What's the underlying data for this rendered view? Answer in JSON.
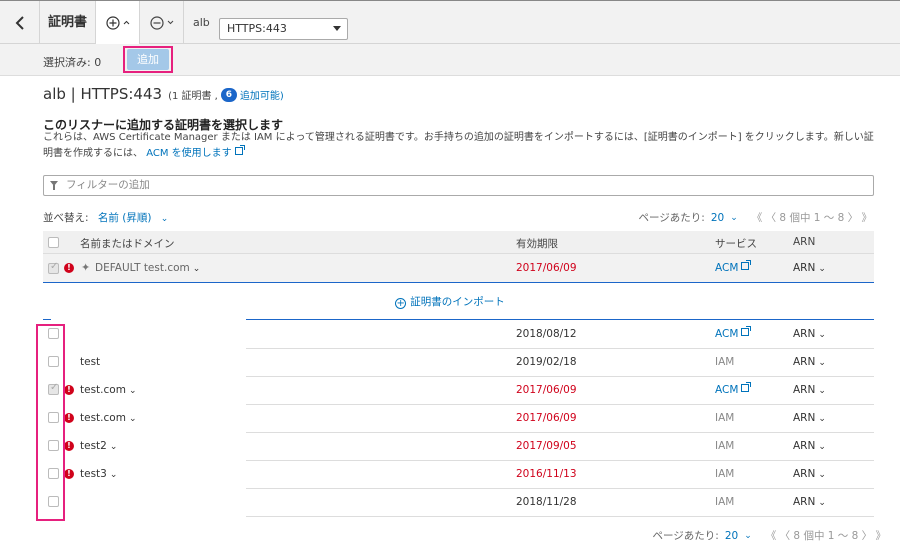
{
  "toolbar": {
    "title": "証明書",
    "load_balancer": "alb",
    "listener": "HTTPS:443"
  },
  "subbar": {
    "selected": "選択済み: 0",
    "add_button": "追加"
  },
  "heading": {
    "title": "alb | HTTPS:443",
    "meta_prefix": "(1 証明書 ,",
    "available_count": "6",
    "meta_link": "追加可能)"
  },
  "section": {
    "title": "このリスナーに追加する証明書を選択します",
    "desc_part1": "これらは、AWS Certificate Manager または IAM によって管理される証明書です。お手持ちの追加の証明書をインポートするには、[証明書のインポート] をクリックします。新しい証明書を作成するには、",
    "desc_link": "ACM を使用します"
  },
  "filter": {
    "placeholder": "フィルターの追加"
  },
  "sort": {
    "label": "並べ替え:",
    "value": "名前 (昇順)"
  },
  "pager": {
    "label": "ページあたり:",
    "size": "20",
    "range": "《 〈 8 個中 1 ～ 8 〉 》"
  },
  "columns": {
    "name": "名前またはドメイン",
    "expiry": "有効期限",
    "service": "サービス",
    "arn": "ARN"
  },
  "default_row": {
    "name": "DEFAULT test.com",
    "expiry": "2017/06/09",
    "service": "ACM",
    "arn": "ARN"
  },
  "import_link": "証明書のインポート",
  "rows": [
    {
      "name": "",
      "expiry": "2018/08/12",
      "service": "ACM",
      "arn": "ARN"
    },
    {
      "name": "test",
      "expiry": "2019/02/18",
      "service": "IAM",
      "arn": "ARN"
    },
    {
      "name": "test.com",
      "expiry": "2017/06/09",
      "service": "ACM",
      "arn": "ARN"
    },
    {
      "name": "test.com",
      "expiry": "2017/06/09",
      "service": "IAM",
      "arn": "ARN"
    },
    {
      "name": "test2",
      "expiry": "2017/09/05",
      "service": "IAM",
      "arn": "ARN"
    },
    {
      "name": "test3",
      "expiry": "2016/11/13",
      "service": "IAM",
      "arn": "ARN"
    },
    {
      "name": "",
      "expiry": "2018/11/28",
      "service": "IAM",
      "arn": "ARN"
    }
  ],
  "colors": {
    "accent": "#0073bb",
    "expired": "#d0021b",
    "highlight": "#e6207e"
  }
}
